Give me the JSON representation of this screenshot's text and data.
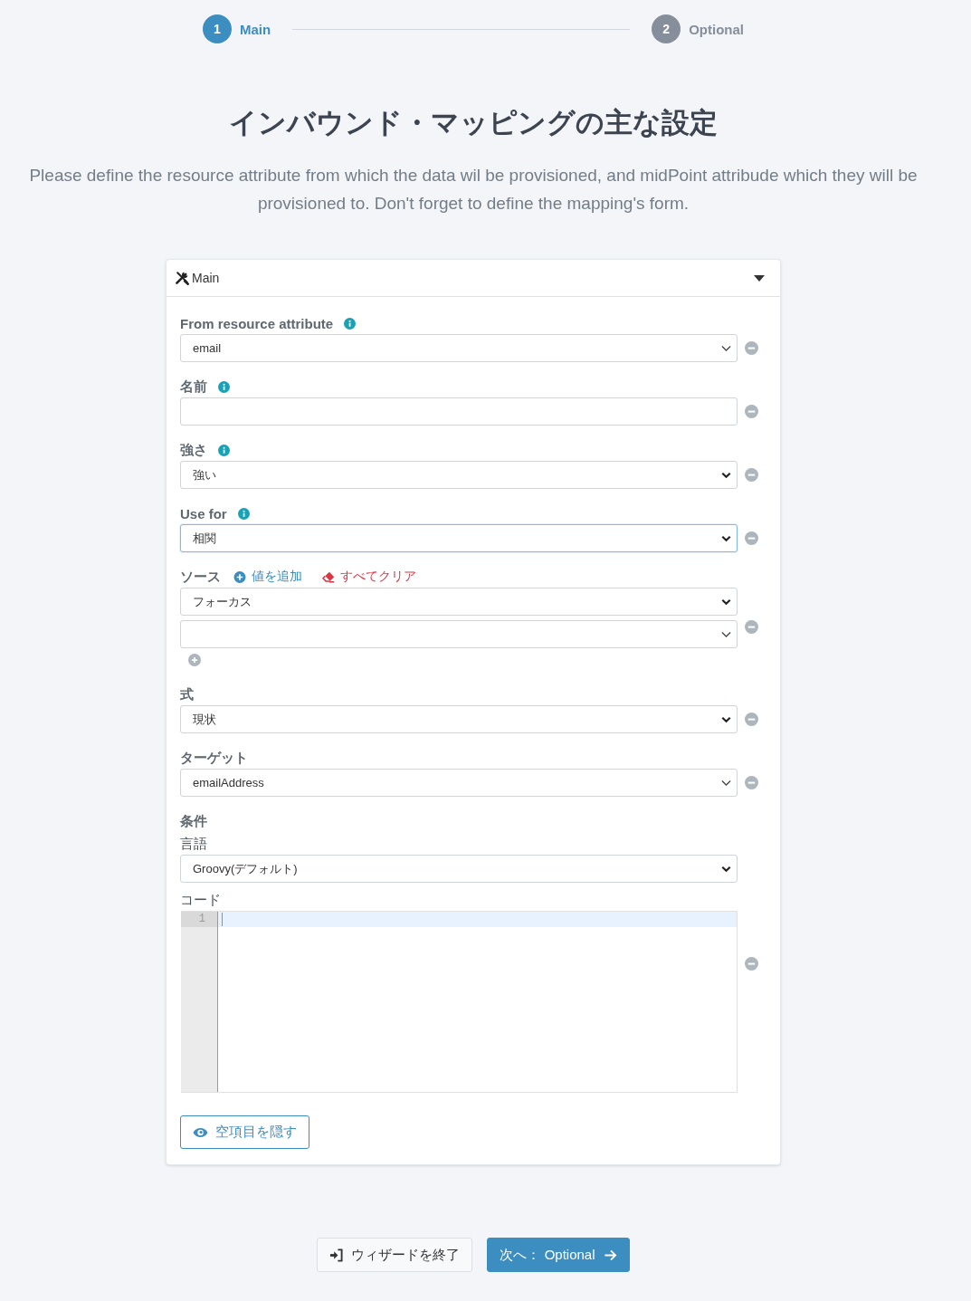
{
  "steps": [
    {
      "number": "1",
      "label": "Main",
      "selected": true
    },
    {
      "number": "2",
      "label": "Optional",
      "selected": false
    }
  ],
  "heading": "インバウンド・マッピングの主な設定",
  "description": "Please define the resource attribute from which the data wil be provisioned, and midPoint attribude which they will be provisioned to. Don't forget to define the mapping's form.",
  "panel": {
    "title": "Main",
    "expanded": true,
    "fields": [
      {
        "kind": "autocomplete",
        "label": "From resource attribute",
        "info": true,
        "value": "email",
        "focused": false
      },
      {
        "kind": "text",
        "label": "名前",
        "info": true,
        "focused": false
      },
      {
        "kind": "select",
        "label": "強さ",
        "info": true,
        "value": "強い",
        "focused": false
      },
      {
        "kind": "select",
        "label": "Use for",
        "info": true,
        "value": "相関",
        "focused": true
      },
      {
        "kind": "multi",
        "label": "ソース",
        "actions": [
          {
            "kind": "add",
            "label": "値を追加"
          },
          {
            "kind": "clear",
            "label": "すべてクリア"
          }
        ],
        "values": [
          {
            "kind": "select",
            "value": "フォーカス",
            "focused": false
          },
          {
            "kind": "autocomplete",
            "focused": false
          }
        ]
      },
      {
        "kind": "select",
        "label": "式",
        "value": "現状",
        "focused": false
      },
      {
        "kind": "autocomplete",
        "label": "ターゲット",
        "value": "emailAddress",
        "focused": false
      },
      {
        "kind": "group",
        "label": "条件",
        "children": [
          {
            "kind": "select",
            "label": "言語",
            "value": "Groovy(デフォルト)",
            "focused": false
          },
          {
            "kind": "code",
            "label": "コード",
            "lines": [
              {
                "number": "1",
                "active": true
              }
            ]
          }
        ]
      }
    ],
    "hide_empty_button": "空項目を隠す"
  },
  "footer": {
    "exit_button": "ウィザードを終了",
    "next_button": "次へ： Optional"
  }
}
